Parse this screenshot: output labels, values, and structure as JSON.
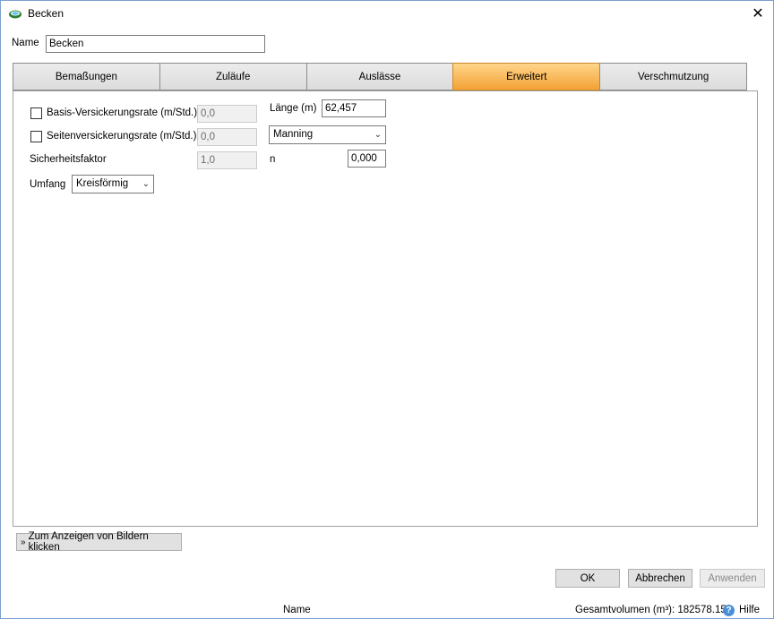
{
  "window": {
    "title": "Becken",
    "close_symbol": "✕"
  },
  "name_field": {
    "label": "Name",
    "value": "Becken"
  },
  "tabs": [
    {
      "label": "Bemaßungen",
      "active": false
    },
    {
      "label": "Zuläufe",
      "active": false
    },
    {
      "label": "Auslässe",
      "active": false
    },
    {
      "label": "Erweitert",
      "active": true
    },
    {
      "label": "Verschmutzung",
      "active": false
    }
  ],
  "erweitert": {
    "basis_rate": {
      "label": "Basis-Versickerungsrate (m/Std.)",
      "value": "0,0",
      "checked": false
    },
    "seiten_rate": {
      "label": "Seitenversickerungsrate (m/Std.)",
      "value": "0,0",
      "checked": false
    },
    "sicherheitsfaktor": {
      "label": "Sicherheitsfaktor",
      "value": "1,0"
    },
    "umfang": {
      "label": "Umfang",
      "value": "Kreisförmig"
    },
    "laenge": {
      "label": "Länge (m)",
      "value": "62,457"
    },
    "method": {
      "value": "Manning"
    },
    "n": {
      "label": "n",
      "value": "0,000"
    }
  },
  "images_button": {
    "label": "Zum Anzeigen von Bildern klicken",
    "icon": "double-chevron-down-icon"
  },
  "buttons": {
    "ok": "OK",
    "cancel": "Abbrechen",
    "apply": "Anwenden"
  },
  "status": {
    "name_label": "Name",
    "volume": "Gesamtvolumen (m³): 182578.157",
    "help": "Hilfe"
  },
  "colors": {
    "active_tab": "#f3a235",
    "help_icon": "#4a90d9"
  }
}
